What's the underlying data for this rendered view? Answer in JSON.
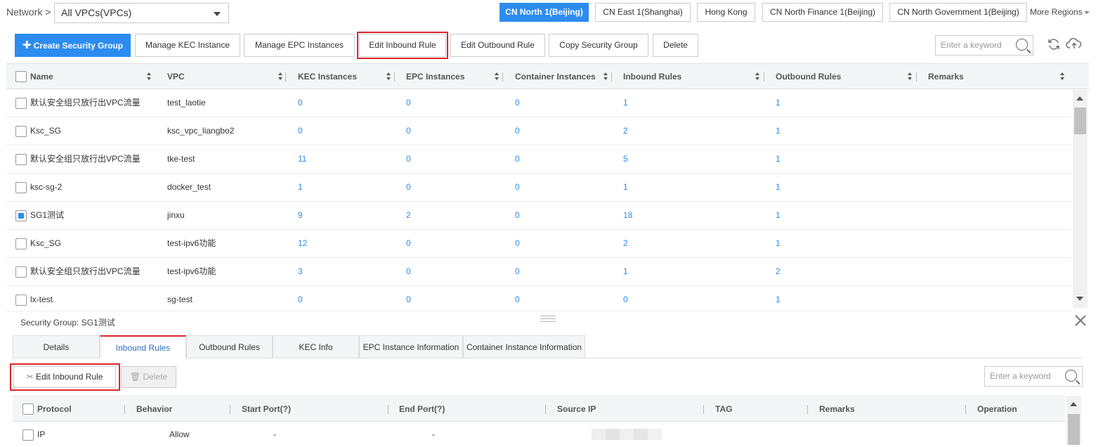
{
  "header": {
    "crumb": "Network >",
    "vpc_select": "All VPCs(VPCs)",
    "regions": [
      {
        "label": "CN North 1(Beijing)",
        "active": true
      },
      {
        "label": "CN East 1(Shanghai)",
        "active": false
      },
      {
        "label": "Hong Kong",
        "active": false
      },
      {
        "label": "CN North Finance 1(Beijing)",
        "active": false
      },
      {
        "label": "CN North Government 1(Beijing)",
        "active": false
      }
    ],
    "more_regions": "More Regions"
  },
  "toolbar": {
    "create": "Create Security Group",
    "manage_kec": "Manage KEC Instance",
    "manage_epc": "Manage EPC Instances",
    "edit_inbound": "Edit Inbound Rule",
    "edit_outbound": "Edit Outbound Rule",
    "copy": "Copy Security Group",
    "delete": "Delete",
    "search_placeholder": "Enter a keyword"
  },
  "table": {
    "columns": [
      "Name",
      "VPC",
      "KEC Instances",
      "EPC Instances",
      "Container Instances",
      "Inbound Rules",
      "Outbound Rules",
      "Remarks"
    ],
    "rows": [
      {
        "name": "默认安全组只放行出VPC流量",
        "vpc": "test_laotie",
        "kec": "0",
        "epc": "0",
        "container": "0",
        "inbound": "1",
        "outbound": "1",
        "checked": false
      },
      {
        "name": "Ksc_SG",
        "vpc": "ksc_vpc_liangbo2",
        "kec": "0",
        "epc": "0",
        "container": "0",
        "inbound": "2",
        "outbound": "1",
        "checked": false
      },
      {
        "name": "默认安全组只放行出VPC流量",
        "vpc": "tke-test",
        "kec": "11",
        "epc": "0",
        "container": "0",
        "inbound": "5",
        "outbound": "1",
        "checked": false
      },
      {
        "name": "ksc-sg-2",
        "vpc": "docker_test",
        "kec": "1",
        "epc": "0",
        "container": "0",
        "inbound": "1",
        "outbound": "1",
        "checked": false
      },
      {
        "name": "SG1测试",
        "vpc": "jinxu",
        "kec": "9",
        "epc": "2",
        "container": "0",
        "inbound": "18",
        "outbound": "1",
        "checked": true
      },
      {
        "name": "Ksc_SG",
        "vpc": "test-ipv6功能",
        "kec": "12",
        "epc": "0",
        "container": "0",
        "inbound": "2",
        "outbound": "1",
        "checked": false
      },
      {
        "name": "默认安全组只放行出VPC流量",
        "vpc": "test-ipv6功能",
        "kec": "3",
        "epc": "0",
        "container": "0",
        "inbound": "1",
        "outbound": "2",
        "checked": false
      },
      {
        "name": "lx-test",
        "vpc": "sg-test",
        "kec": "0",
        "epc": "0",
        "container": "0",
        "inbound": "0",
        "outbound": "1",
        "checked": false
      }
    ]
  },
  "detail": {
    "label": "Security Group:  SG1测试",
    "tabs": [
      "Details",
      "Inbound Rules",
      "Outbound Rules",
      "KEC Info",
      "EPC Instance Information",
      "Container Instance Information"
    ],
    "active_tab": "Inbound Rules",
    "edit_inbound": "Edit Inbound Rule",
    "delete": "Delete",
    "search_placeholder": "Enter a keyword",
    "columns": [
      "Protocol",
      "Behavior",
      "Start Port(?)",
      "End Port(?)",
      "Source IP",
      "TAG",
      "Remarks",
      "Operation"
    ],
    "rows": [
      {
        "protocol": "IP",
        "behavior": "Allow",
        "start_port": "-",
        "end_port": "-"
      }
    ]
  },
  "colors": {
    "accent": "#2d8cf0",
    "highlight": "#d9262c"
  }
}
